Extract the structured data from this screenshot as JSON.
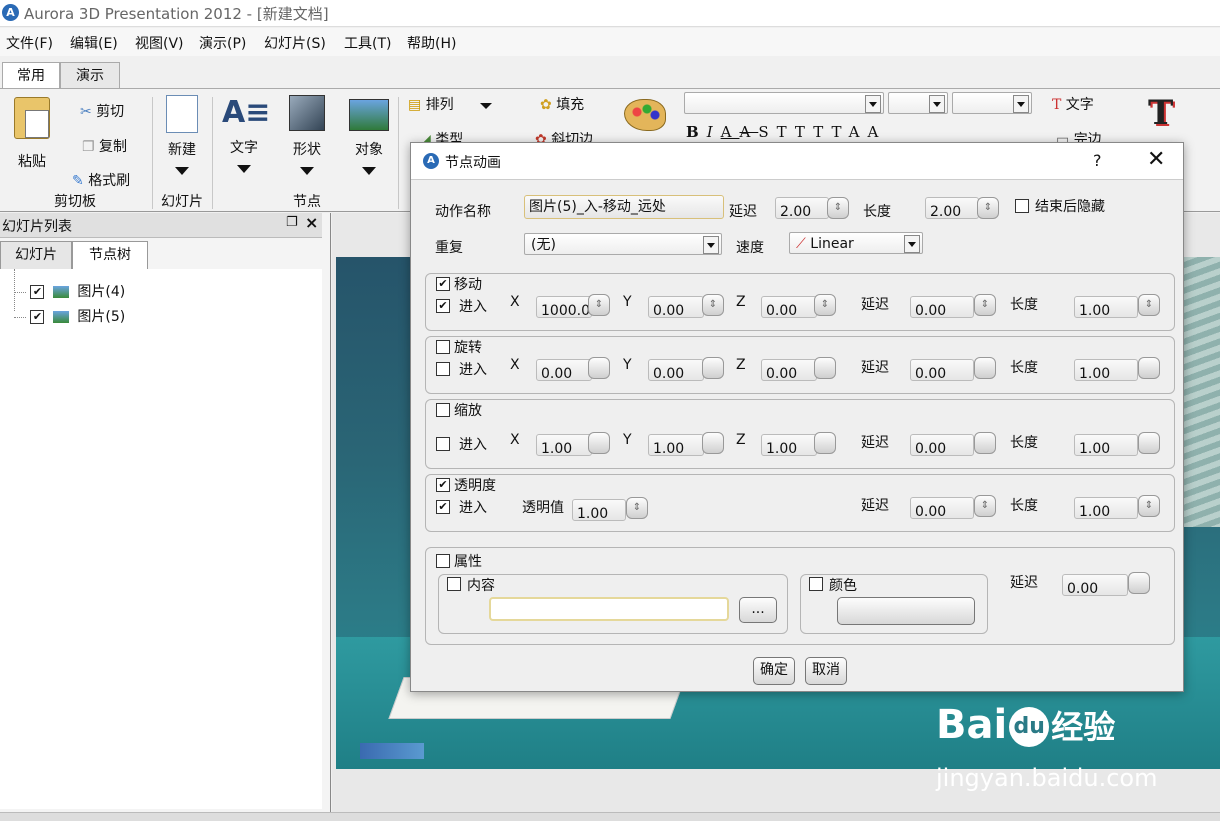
{
  "window": {
    "title": "Aurora 3D Presentation 2012 - [新建文档]"
  },
  "menu": [
    "文件(F)",
    "编辑(E)",
    "视图(V)",
    "演示(P)",
    "幻灯片(S)",
    "工具(T)",
    "帮助(H)"
  ],
  "ribbon": {
    "tabs": [
      "常用",
      "演示"
    ],
    "clipboard": {
      "paste": "粘贴",
      "cut": "剪切",
      "copy": "复制",
      "format_painter": "格式刷",
      "group": "剪切板"
    },
    "slide": {
      "new": "新建",
      "group": "幻灯片"
    },
    "node": {
      "text": "文字",
      "shape": "形状",
      "object": "对象",
      "group": "节点"
    },
    "arrange": "排列",
    "fill": "填充",
    "type": "类型",
    "bevel": "斜切边",
    "format_letters": [
      "B",
      "I",
      "A",
      "A",
      "S",
      "T",
      "T",
      "T",
      "T",
      "A",
      "A"
    ],
    "text_btn": "文字",
    "complete_btn": "完边"
  },
  "panel": {
    "title": "幻灯片列表",
    "tabs": [
      "幻灯片",
      "节点树"
    ],
    "tree": [
      {
        "label": "图片(4)",
        "checked": true
      },
      {
        "label": "图片(5)",
        "checked": true
      }
    ]
  },
  "dialog": {
    "title": "节点动画",
    "help": "?",
    "action_name_label": "动作名称",
    "action_name": "图片(5)_入-移动_远处",
    "delay_label": "延迟",
    "delay": "2.00",
    "length_label": "长度",
    "length": "2.00",
    "hide_after_label": "结束后隐藏",
    "hide_after": false,
    "repeat_label": "重复",
    "repeat": "(无)",
    "speed_label": "速度",
    "speed": "Linear",
    "sections": [
      {
        "title": "移动",
        "checked": true,
        "enter_label": "进入",
        "enter": true,
        "x": "1000.0",
        "y": "0.00",
        "z": "0.00",
        "delay": "0.00",
        "length": "1.00"
      },
      {
        "title": "旋转",
        "checked": false,
        "enter_label": "进入",
        "enter": false,
        "x": "0.00",
        "y": "0.00",
        "z": "0.00",
        "delay": "0.00",
        "length": "1.00"
      },
      {
        "title": "缩放",
        "checked": false,
        "enter_label": "进入",
        "enter": false,
        "x": "1.00",
        "y": "1.00",
        "z": "1.00",
        "delay": "0.00",
        "length": "1.00"
      }
    ],
    "axis_labels": [
      "X",
      "Y",
      "Z"
    ],
    "sec_delay_label": "延迟",
    "sec_length_label": "长度",
    "opacity": {
      "title": "透明度",
      "checked": true,
      "enter_label": "进入",
      "enter": true,
      "value_label": "透明值",
      "value": "1.00",
      "delay": "0.00",
      "length": "1.00"
    },
    "attribute": {
      "title": "属性",
      "checked": false,
      "content_label": "内容",
      "content": "",
      "browse": "...",
      "color_label": "颜色",
      "delay_label": "延迟",
      "delay": "0.00"
    },
    "ok": "确定",
    "cancel": "取消"
  },
  "watermark": {
    "logo": "Bai",
    "logo2": "du",
    "brand": "经验",
    "url": "jingyan.baidu.com"
  }
}
